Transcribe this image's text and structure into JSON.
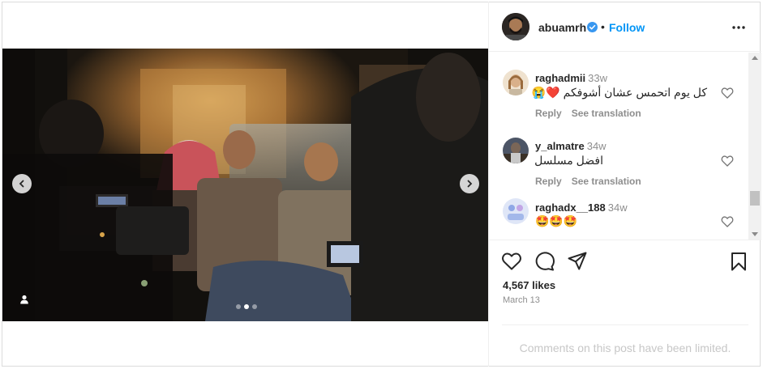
{
  "post": {
    "username": "abuamrh",
    "separator": "•",
    "follow_label": "Follow",
    "media": {
      "slide_count": 3,
      "active_slide": 2
    }
  },
  "comments": [
    {
      "username": "raghadmii",
      "time": "33w",
      "text": "كل يوم اتحمس عشان أشوفكم ❤️😭",
      "reply_label": "Reply",
      "translate_label": "See translation"
    },
    {
      "username": "y_almatre",
      "time": "34w",
      "text": "افضل مسلسل",
      "reply_label": "Reply",
      "translate_label": "See translation"
    },
    {
      "username": "raghadx__188",
      "time": "34w",
      "text": "🤩🤩🤩"
    }
  ],
  "engagement": {
    "likes": "4,567 likes",
    "date": "March 13"
  },
  "footer": {
    "limited_text": "Comments on this post have been limited."
  },
  "colors": {
    "accent": "#0095f6",
    "verified": "#3897f0",
    "secondary_text": "#8e8e8e",
    "border": "#dbdbdb"
  }
}
